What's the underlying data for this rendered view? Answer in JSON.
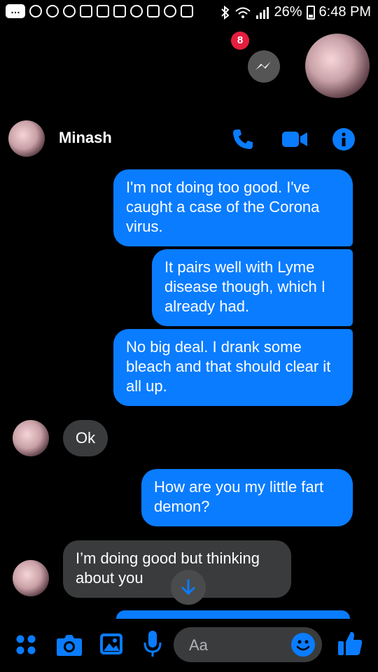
{
  "status_bar": {
    "battery": "26%",
    "time": "6:48 PM"
  },
  "chat_head": {
    "badge_count": "8"
  },
  "header": {
    "contact_name": "Minash"
  },
  "messages": [
    {
      "direction": "outgoing",
      "text": "I'm not doing too good. I've caught a case of the Corona virus."
    },
    {
      "direction": "outgoing",
      "text": "It pairs well with Lyme disease though, which I already had."
    },
    {
      "direction": "outgoing",
      "text": "No big deal. I drank some bleach and that should clear it all up."
    },
    {
      "direction": "incoming",
      "text": "Ok"
    },
    {
      "direction": "outgoing",
      "text": "How are you my little fart demon?"
    },
    {
      "direction": "incoming",
      "text": "I’m doing good but thinking about you"
    }
  ],
  "composer": {
    "placeholder": "Aa"
  },
  "colors": {
    "outgoing_bubble": "#0a7cff",
    "incoming_bubble": "#3a3b3c",
    "accent": "#0a7cff",
    "badge": "#e41e3f"
  }
}
